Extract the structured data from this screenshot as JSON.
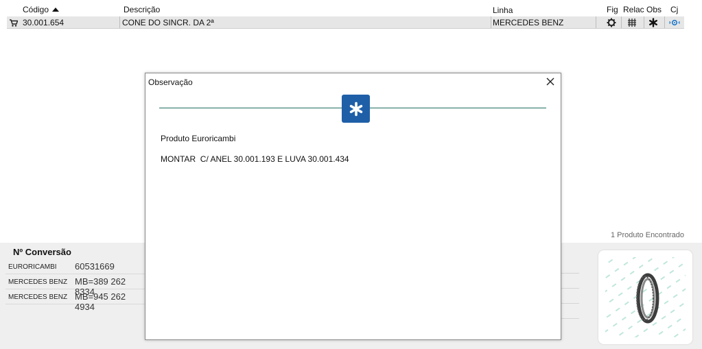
{
  "table": {
    "headers": {
      "codigo": "Código",
      "descricao": "Descrição",
      "linha": "Linha",
      "fig": "Fig",
      "relac": "Relac",
      "obs": "Obs",
      "cj": "Cj"
    },
    "row": {
      "codigo": "30.001.654",
      "descricao": "CONE DO SINCR. DA 2ª",
      "linha": "MERCEDES BENZ"
    }
  },
  "status": {
    "found": "1 Produto Encontrado"
  },
  "conversion": {
    "title": "Nº Conversão",
    "items": [
      {
        "brand": "EURORICAMBI",
        "number": "60531669"
      },
      {
        "brand": "MERCEDES BENZ",
        "number": "MB=389 262 8334"
      },
      {
        "brand": "MERCEDES BENZ",
        "number": "MB=945 262 4934"
      }
    ]
  },
  "modal": {
    "title": "Observação",
    "line1": "Produto Euroricambi",
    "line2": "MONTAR  C/ ANEL 30.001.193 E LUVA 30.001.434"
  },
  "colors": {
    "accent_blue": "#1f5fa8",
    "divider_green": "#1d6b5c",
    "row_bg": "#e6e6e6",
    "cj_icon": "#1e78c8"
  },
  "icons": {
    "row": "cart-icon",
    "fig": "gear-icon",
    "relac": "relation-icon",
    "obs": "asterisk-icon",
    "cj": "set-icon",
    "modal": "asterisk-icon",
    "close": "close-icon"
  }
}
